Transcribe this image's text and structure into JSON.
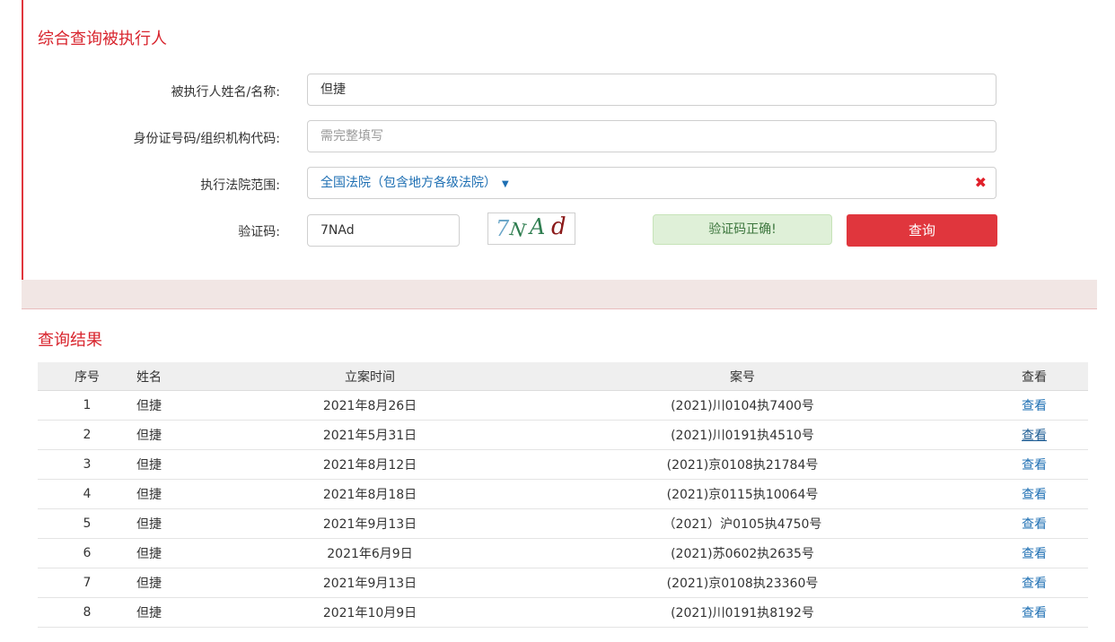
{
  "form": {
    "title": "综合查询被执行人",
    "name_label": "被执行人姓名/名称:",
    "name_value": "但捷",
    "id_label": "身份证号码/组织机构代码:",
    "id_placeholder": "需完整填写",
    "court_label": "执行法院范围:",
    "court_value": "全国法院（包含地方各级法院）",
    "captcha_label": "验证码:",
    "captcha_value": "7NAd",
    "captcha_image_text": "7NAd",
    "captcha_status": "验证码正确!",
    "search_button": "查询"
  },
  "results": {
    "title": "查询结果",
    "headers": [
      "序号",
      "姓名",
      "立案时间",
      "案号",
      "查看"
    ],
    "rows": [
      {
        "idx": "1",
        "name": "但捷",
        "date": "2021年8月26日",
        "case_no": "(2021)川0104执7400号",
        "view": "查看"
      },
      {
        "idx": "2",
        "name": "但捷",
        "date": "2021年5月31日",
        "case_no": "(2021)川0191执4510号",
        "view": "查看"
      },
      {
        "idx": "3",
        "name": "但捷",
        "date": "2021年8月12日",
        "case_no": "(2021)京0108执21784号",
        "view": "查看"
      },
      {
        "idx": "4",
        "name": "但捷",
        "date": "2021年8月18日",
        "case_no": "(2021)京0115执10064号",
        "view": "查看"
      },
      {
        "idx": "5",
        "name": "但捷",
        "date": "2021年9月13日",
        "case_no": "（2021）沪0105执4750号",
        "view": "查看"
      },
      {
        "idx": "6",
        "name": "但捷",
        "date": "2021年6月9日",
        "case_no": "(2021)苏0602执2635号",
        "view": "查看"
      },
      {
        "idx": "7",
        "name": "但捷",
        "date": "2021年9月13日",
        "case_no": "(2021)京0108执23360号",
        "view": "查看"
      },
      {
        "idx": "8",
        "name": "但捷",
        "date": "2021年10月9日",
        "case_no": "(2021)川0191执8192号",
        "view": "查看"
      }
    ]
  },
  "colors": {
    "accent": "#e0363d",
    "link": "#1e6fb3",
    "success_bg": "#dff0d8"
  },
  "icons": {
    "dropdown": "caret-down-icon",
    "clear": "close-icon"
  }
}
